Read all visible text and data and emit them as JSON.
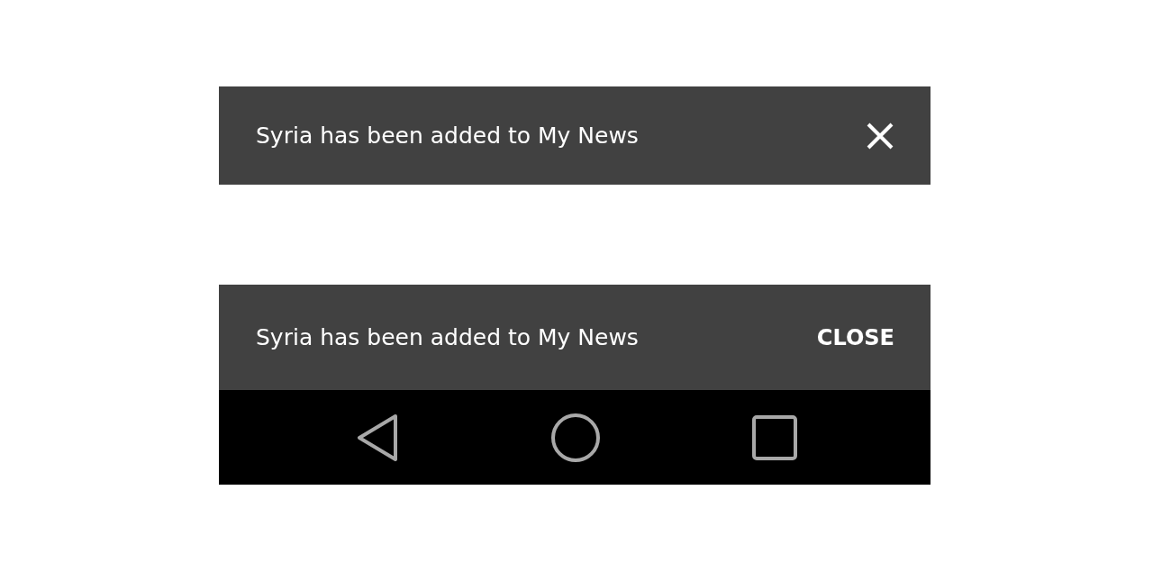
{
  "snackbars": [
    {
      "message": "Syria has been added to My News",
      "action": {
        "kind": "icon"
      },
      "nav_bar": false
    },
    {
      "message": "Syria has been added to My News",
      "action": {
        "kind": "text",
        "label": "CLOSE"
      },
      "nav_bar": true
    }
  ]
}
